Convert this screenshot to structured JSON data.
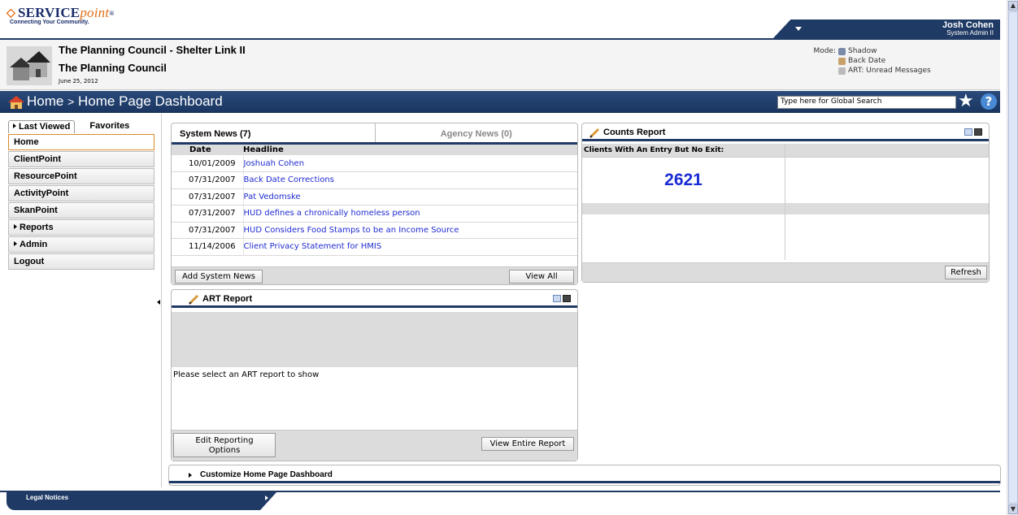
{
  "header": {
    "logo_text_a": "SERVICE",
    "logo_text_b": "point",
    "logo_tm": "®",
    "tagline": "Connecting Your Community.",
    "user_name": "Josh Cohen",
    "user_role": "System Admin II",
    "org_title": "The Planning Council - Shelter Link II",
    "agency_name": "The Planning Council",
    "date": "June 25, 2012",
    "mode_label": "Mode:",
    "mode_items": [
      "Shadow",
      "Back Date",
      "ART: Unread Messages"
    ]
  },
  "breadcrumb": {
    "home": "Home",
    "separator": ">",
    "page": "Home Page Dashboard"
  },
  "search": {
    "placeholder": "Type here for Global Search"
  },
  "nav": {
    "tabs": [
      "Last Viewed",
      "Favorites"
    ],
    "items": [
      {
        "label": "Home",
        "active": true
      },
      {
        "label": "ClientPoint"
      },
      {
        "label": "ResourcePoint"
      },
      {
        "label": "ActivityPoint"
      },
      {
        "label": "SkanPoint"
      },
      {
        "label": "Reports",
        "expandable": true
      },
      {
        "label": "Admin",
        "expandable": true
      },
      {
        "label": "Logout"
      }
    ]
  },
  "news": {
    "tab_system": "System News (7)",
    "tab_agency": "Agency News (0)",
    "col_date": "Date",
    "col_headline": "Headline",
    "rows": [
      {
        "date": "10/01/2009",
        "headline": "Joshuah Cohen"
      },
      {
        "date": "07/31/2007",
        "headline": "Back Date Corrections"
      },
      {
        "date": "07/31/2007",
        "headline": "Pat Vedomske"
      },
      {
        "date": "07/31/2007",
        "headline": "HUD defines a chronically homeless person"
      },
      {
        "date": "07/31/2007",
        "headline": "HUD Considers Food Stamps to be an Income Source"
      },
      {
        "date": "11/14/2006",
        "headline": "Client Privacy Statement for HMIS"
      }
    ],
    "add_button": "Add System News",
    "view_all_button": "View All"
  },
  "counts": {
    "title": "Counts Report",
    "header": "Clients With An Entry But No Exit:",
    "value": "2621",
    "refresh_button": "Refresh"
  },
  "art": {
    "title": "ART Report",
    "message": "Please select an ART report to show",
    "edit_button_line1": "Edit Reporting",
    "edit_button_line2": "Options",
    "view_button": "View Entire Report"
  },
  "customize": {
    "label": "Customize Home Page Dashboard"
  },
  "footer": {
    "legal": "Legal Notices"
  },
  "colors": {
    "brand_navy": "#1f3a64",
    "brand_orange": "#e0701a",
    "link": "#1f2bd1",
    "count": "#1a2bd4"
  }
}
